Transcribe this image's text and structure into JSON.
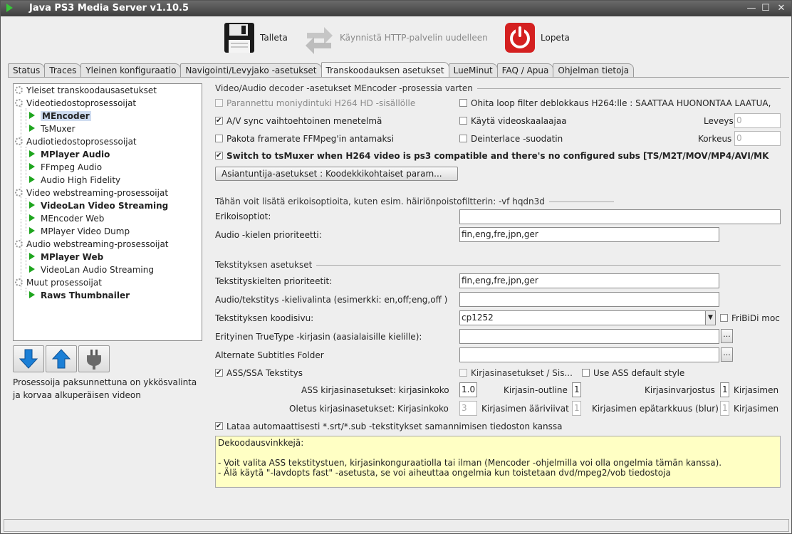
{
  "window": {
    "title": "Java PS3 Media Server v1.10.5"
  },
  "toolbar": {
    "save": "Talleta",
    "restart": "Käynnistä HTTP-palvelin uudelleen",
    "quit": "Lopeta"
  },
  "tabs": [
    "Status",
    "Traces",
    "Yleinen konfiguraatio",
    "Navigointi/Levyjako -asetukset",
    "Transkoodauksen asetukset",
    "LueMinut",
    "FAQ / Apua",
    "Ohjelman tietoja"
  ],
  "tree": [
    {
      "label": "Yleiset transkoodausasetukset"
    },
    {
      "label": "Videotiedostoprosessoijat"
    },
    {
      "label": "MEncoder"
    },
    {
      "label": "TsMuxer"
    },
    {
      "label": "Audiotiedostoprosessoijat"
    },
    {
      "label": "MPlayer Audio"
    },
    {
      "label": "FFmpeg Audio"
    },
    {
      "label": "Audio High Fidelity"
    },
    {
      "label": "Video webstreaming-prosessoijat"
    },
    {
      "label": "VideoLan Video Streaming"
    },
    {
      "label": "MEncoder Web"
    },
    {
      "label": "MPlayer Video Dump"
    },
    {
      "label": "Audio webstreaming-prosessoijat"
    },
    {
      "label": "MPlayer Web"
    },
    {
      "label": "VideoLan Audio Streaming"
    },
    {
      "label": "Muut prosessoijat"
    },
    {
      "label": "Raws Thumbnailer"
    }
  ],
  "tree_note": [
    "Prosessoija paksunnettuna on ykkösvalinta",
    "ja korvaa alkuperäisen videon"
  ],
  "sections": {
    "decoder": "Video/Audio decoder -asetukset MEncoder -prosessia varten",
    "custom": "Tähän voit lisätä erikoisoptioita, kuten esim. häiriönpoistofiltterin: -vf hqdn3d",
    "subs": "Tekstityksen asetukset"
  },
  "decoder": {
    "multithread": "Parannettu moniydintuki H264 HD -sisällölle",
    "skiploop": "Ohita loop filter deblokkaus H264:lle : SAATTAA HUONONTAA LAATUA,",
    "avsync": "A/V sync vaihtoehtoinen menetelmä",
    "scaler": "Käytä videoskaalaajaa",
    "width_label": "Leveys",
    "width_value": "0",
    "framerate": "Pakota framerate FFMpeg'in antamaksi",
    "deinterlace": "Deinterlace -suodatin",
    "height_label": "Korkeus",
    "height_value": "0",
    "tsmuxer_switch": "Switch to tsMuxer when H264 video is ps3 compatible and there's no configured subs [TS/M2T/MOV/MP4/AVI/MK",
    "expert_button": "Asiantuntija-asetukset : Koodekkikohtaiset param..."
  },
  "custom": {
    "options_label": "Erikoisoptiot:",
    "options_value": "",
    "audio_lang_label": "Audio -kielen prioriteetti:",
    "audio_lang_value": "fin,eng,fre,jpn,ger"
  },
  "subs": {
    "sub_lang_label": "Tekstityskielten prioriteetit:",
    "sub_lang_value": "fin,eng,fre,jpn,ger",
    "audio_sub_label": "Audio/tekstitys -kielivalinta (esimerkki:  en,off;eng,off )",
    "audio_sub_value": "",
    "codepage_label": "Tekstityksen koodisivu:",
    "codepage_value": "cp1252",
    "fribidi": "FriBiDi moc",
    "truetype_label": "Erityinen TrueType -kirjasin (aasialaisille kielille):",
    "truetype_value": "",
    "alt_folder_label": "Alternate Subtitles Folder",
    "alt_folder_value": "",
    "browse": "...",
    "ass": "ASS/SSA Tekstitys",
    "font_settings": "Kirjasinasetukset / Sis...",
    "ass_default": "Use ASS default style",
    "ass_font_label": "ASS kirjasinasetukset: kirjasinkoko",
    "ass_font_value": "1.0",
    "outline_label": "Kirjasin-outline",
    "outline_value": "1",
    "shadow_label": "Kirjasinvarjostus",
    "shadow_value": "1",
    "margin_label": "Kirjasimen",
    "def_font_label": "Oletus kirjasinasetukset: Kirjasinkoko",
    "def_font_value": "3",
    "border_label": "Kirjasimen ääriviivat",
    "border_value": "1",
    "blur_label": "Kirjasimen epätarkkuus (blur)",
    "blur_value": "1",
    "margin2_label": "Kirjasimen",
    "autoload": "Lataa automaattisesti *.srt/*.sub -tekstitykset samannimisen tiedoston kanssa"
  },
  "tips": {
    "title": "Dekoodausvinkkejä:",
    "line1": "- Voit valita ASS tekstitystuen, kirjasinkonguraatiolla tai ilman (Mencoder -ohjelmilla voi olla ongelmia tämän kanssa).",
    "line2": "- Älä käytä \"-lavdopts fast\" -asetusta, se voi aiheuttaa ongelmia kun toistetaan dvd/mpeg2/vob tiedostoja"
  },
  "colors": {
    "titlebar": "#4a4a4a",
    "tree_selection": "#cfdcf0",
    "tips_bg": "#ffffc4",
    "play_green": "#1ea51e",
    "quit_red": "#d42020",
    "arrow_blue": "#1b7fd6"
  }
}
